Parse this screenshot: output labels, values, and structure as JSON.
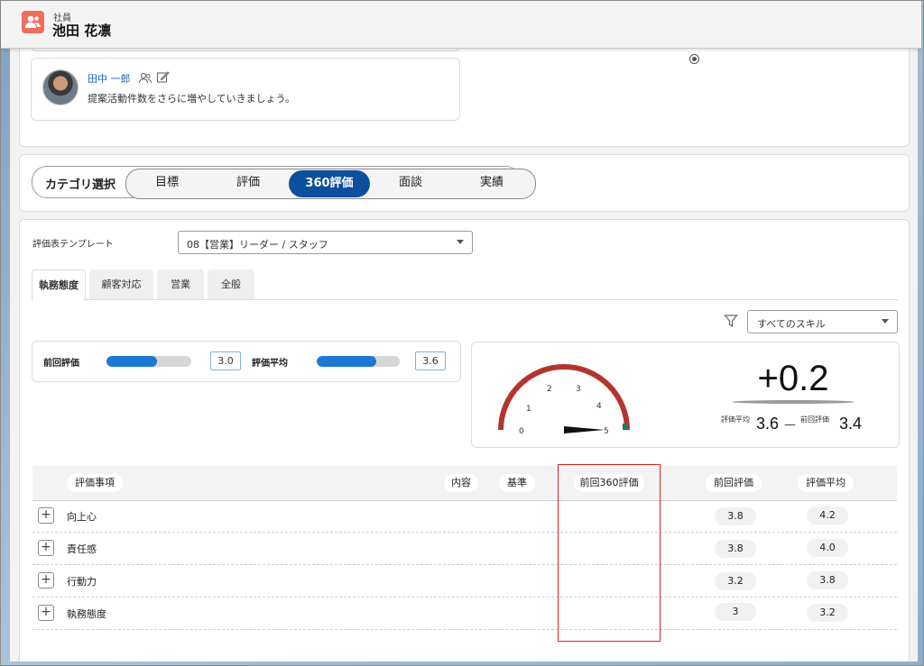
{
  "header": {
    "object_label": "社員",
    "record_name": "池田 花凛",
    "icon": "people-icon"
  },
  "comment": {
    "author": "田中 一郎",
    "text": "提案活動件数をさらに増やしていきましょう。",
    "icons": [
      "people-icon",
      "edit-icon"
    ]
  },
  "category": {
    "label": "カテゴリ選択",
    "items": [
      "目標",
      "評価",
      "360評価",
      "面談",
      "実績"
    ],
    "selected": "360評価"
  },
  "template": {
    "label": "評価表テンプレート",
    "value": "08【営業】リーダー / スタッフ"
  },
  "tabs": [
    {
      "label": "執務態度",
      "active": true
    },
    {
      "label": "顧客対応",
      "active": false
    },
    {
      "label": "営業",
      "active": false
    },
    {
      "label": "全般",
      "active": false
    }
  ],
  "skill_filter": {
    "value": "すべてのスキル",
    "icon": "filter-icon"
  },
  "summary": {
    "prev_label": "前回評価",
    "prev_value": "3.0",
    "prev_fraction": 0.6,
    "avg_label": "評価平均",
    "avg_value": "3.6",
    "avg_fraction": 0.72
  },
  "gauge": {
    "ticks": [
      "0",
      "1",
      "2",
      "3",
      "4",
      "5"
    ],
    "value": 5,
    "delta": "+0.2",
    "avg_label": "評価平均",
    "avg_value": "3.6",
    "dash": "—",
    "prev_label": "前回評価",
    "prev_value": "3.4"
  },
  "table": {
    "headers": {
      "item": "評価事項",
      "content": "内容",
      "criteria": "基準",
      "prev360": "前回360評価",
      "prev": "前回評価",
      "avg": "評価平均"
    },
    "rows": [
      {
        "label": "向上心",
        "prev": "3.8",
        "avg": "4.2"
      },
      {
        "label": "責任感",
        "prev": "3.8",
        "avg": "4.0"
      },
      {
        "label": "行動力",
        "prev": "3.2",
        "avg": "3.8"
      },
      {
        "label": "執務態度",
        "prev": "3",
        "avg": "3.2"
      }
    ]
  },
  "colors": {
    "accent": "#0b4f9e",
    "bar": "#1c78d3",
    "gauge_arc": "#b5342c",
    "highlight_box": "#e02020",
    "header_icon": "#ef6f5d"
  }
}
